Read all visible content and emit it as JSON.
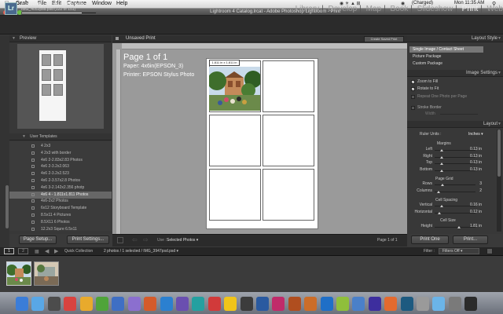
{
  "menubar": {
    "app": "Grab",
    "items": [
      "File",
      "Edit",
      "Capture",
      "Window",
      "Help"
    ],
    "status": {
      "battery": "(Charged)",
      "clock": "Mon 11:35 AM"
    }
  },
  "window": {
    "title": "Lightroom 4 Catalog.lrcat - Adobe Photoshop Lightroom - Print"
  },
  "header": {
    "logo": "Lr",
    "status_title": "Rendering Standard Previews",
    "status_file": "IMG_4052psd.psd (122 of 151)",
    "progress": 0.81,
    "modules": [
      {
        "label": "Library",
        "active": false
      },
      {
        "label": "Develop",
        "active": false
      },
      {
        "label": "Map",
        "active": false
      },
      {
        "label": "Book",
        "active": false
      },
      {
        "label": "Slideshow",
        "active": false
      },
      {
        "label": "Print",
        "active": true
      },
      {
        "label": "Web",
        "active": false
      }
    ]
  },
  "left": {
    "preview_title": "Preview",
    "templates_title": "User Templates",
    "templates": [
      "4 2x3",
      "4 2x3 with border",
      "4x6 2-2.83x2.83 Photos",
      "4x6 2-3.2x2.063",
      "4x6 2-3.2x2.523",
      "4x6 2-3.57x2.8 Photos",
      "4x6 3-2.142x2.356 photp",
      "4x6 4 - 1.811x1.811 Photos",
      "4x6-2x2 Photos",
      "6x12 Storyboard Template",
      "8.5x11 4 Pictures",
      "8.5X11 6 Photos",
      "12.2x3 Squre 6.5x11"
    ],
    "selected_template_index": 7,
    "page_setup_button": "Page Setup...",
    "print_settings_button": "Print Settings..."
  },
  "center": {
    "title": "Unsaved Print",
    "create_button": "Create Saved Print",
    "page_label": "Page 1 of 1",
    "paper_label": "Paper:  4x6in(EPSON_3)",
    "printer_label": "Printer:  EPSON Stylus Photo",
    "cell_size_tag": "1.811 in x 1.811 in",
    "use_label": "Use :",
    "use_value": "Selected Photos",
    "page_counter": "Page 1 of 1"
  },
  "right": {
    "layout_style_title": "Layout Style",
    "layout_styles": [
      "Single Image / Contact Sheet",
      "Picture Package",
      "Custom Package"
    ],
    "layout_style_selected": 0,
    "image_settings_title": "Image Settings",
    "zoom_to_fill": "Zoom to Fill",
    "rotate_to_fit": "Rotate to Fit",
    "repeat_one_photo": "Repeat One Photo per Page",
    "stroke_border": "Stroke Border",
    "stroke_width_label": "Width",
    "layout_title": "Layout",
    "ruler_units_label": "Ruler Units :",
    "ruler_units_value": "Inches",
    "margins_title": "Margins",
    "margins": [
      {
        "label": "Left",
        "value": "0.13 in",
        "level": 0.18
      },
      {
        "label": "Right",
        "value": "0.13 in",
        "level": 0.18
      },
      {
        "label": "Top",
        "value": "0.13 in",
        "level": 0.18
      },
      {
        "label": "Bottom",
        "value": "0.13 in",
        "level": 0.18
      }
    ],
    "page_grid_title": "Page Grid",
    "grid": [
      {
        "label": "Rows",
        "value": "3",
        "level": 0.2
      },
      {
        "label": "Columns",
        "value": "2",
        "level": 0.1
      }
    ],
    "cell_spacing_title": "Cell Spacing",
    "spacing": [
      {
        "label": "Vertical",
        "value": "0.16 in",
        "level": 0.17
      },
      {
        "label": "Horizontal",
        "value": "0.12 in",
        "level": 0.12
      }
    ],
    "cell_size_title": "Cell Size",
    "cell_size": [
      {
        "label": "Height",
        "value": "1.81 in",
        "level": 0.6
      }
    ],
    "print_one_button": "Print One",
    "print_button": "Print..."
  },
  "filmstrip": {
    "page_1": "1",
    "page_2": "2",
    "source": "Quick Collection",
    "selection_info": "2 photos / 1 selected / IMG_3947psd.psd",
    "filter_label": "Filter :",
    "filter_value": "Filters Off"
  },
  "dock": {
    "colors": [
      "#3b7dd8",
      "#59a7e6",
      "#4c4c4c",
      "#d9433f",
      "#e8aa2c",
      "#4fa43a",
      "#3f6fc4",
      "#8b6fcf",
      "#d55b2a",
      "#2b80d0",
      "#6a4fb0",
      "#24a0a0",
      "#d13a3a",
      "#f0c419",
      "#3c3c3c",
      "#2a5aa0",
      "#c02b6a",
      "#b04e1f",
      "#cc6d28",
      "#1f6fc7",
      "#8fbf3b",
      "#4a80c9",
      "#3d2e9e",
      "#e36a2f",
      "#1d5a80",
      "#9a9a9a",
      "#6bb4e8",
      "#7a7a7a",
      "#2b2b2b"
    ]
  }
}
